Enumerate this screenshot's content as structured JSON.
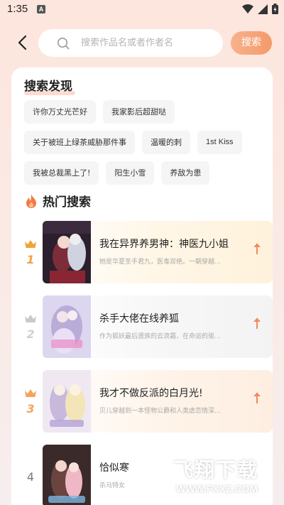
{
  "status": {
    "time": "1:35",
    "badge": "A",
    "icons": [
      "wifi-icon",
      "signal-icon",
      "battery-icon"
    ]
  },
  "search": {
    "placeholder": "搜索作品名或者作者名",
    "button_label": "搜索",
    "back_icon": "back-arrow-icon"
  },
  "discover": {
    "title": "搜索发现",
    "tags": [
      [
        "许你万丈光芒好",
        "我家影后超甜哒"
      ],
      [
        "关于被班上绿茶威胁那件事",
        "温暖的刺",
        "1st Kiss"
      ],
      [
        "我被总裁黑上了!",
        "阳生小雪",
        "养敌为患"
      ]
    ]
  },
  "hot": {
    "title": "热门搜索",
    "icon": "fire-icon",
    "items": [
      {
        "rank": "1",
        "title": "我在异界养男神：神医九小姐",
        "desc": "她是华夏圣手君九，医毒双绝。一朝穿越…",
        "crown": "gold"
      },
      {
        "rank": "2",
        "title": "杀手大佬在线养狐",
        "desc": "作为狐妖最后遗族的云流霜，在命运的驱…",
        "crown": "silver"
      },
      {
        "rank": "3",
        "title": "我才不做反派的白月光!",
        "desc": "贝儿穿越到一本怪物公爵和人类虐恋情深…",
        "crown": "bronze"
      },
      {
        "rank": "4",
        "title": "恰似寒",
        "desc": "杀马特女",
        "crown": "none"
      }
    ]
  },
  "watermark": {
    "text": "飞翔下载",
    "url": "WWW.FXXZ.COM"
  },
  "colors": {
    "accent": "#f39a6b",
    "gold": "#f3a23c",
    "silver": "#c9c9c9",
    "bronze": "#f4a45a",
    "trend_arrow": "#f08a5d"
  }
}
